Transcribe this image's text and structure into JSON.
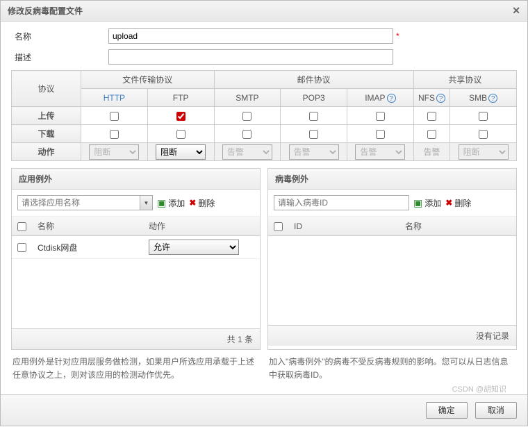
{
  "title": "修改反病毒配置文件",
  "form": {
    "name_label": "名称",
    "name_value": "upload",
    "desc_label": "描述",
    "desc_value": ""
  },
  "proto": {
    "col_protocol": "协议",
    "group_file": "文件传输协议",
    "group_mail": "邮件协议",
    "group_share": "共享协议",
    "http": "HTTP",
    "ftp": "FTP",
    "smtp": "SMTP",
    "pop3": "POP3",
    "imap": "IMAP",
    "nfs": "NFS",
    "smb": "SMB",
    "row_upload": "上传",
    "row_download": "下载",
    "row_action": "动作",
    "act_block": "阻断",
    "act_alert": "告警"
  },
  "app_ex": {
    "title": "应用例外",
    "placeholder": "请选择应用名称",
    "add": "添加",
    "del": "删除",
    "col_name": "名称",
    "col_action": "动作",
    "row1_name": "Ctdisk网盘",
    "row1_action": "允许",
    "pager": "共 1 条",
    "hint": "应用例外是针对应用层服务做检测，如果用户所选应用承载于上述任意协议之上，则对该应用的检测动作优先。"
  },
  "virus_ex": {
    "title": "病毒例外",
    "placeholder": "请输入病毒ID",
    "add": "添加",
    "del": "删除",
    "col_id": "ID",
    "col_name": "名称",
    "pager": "没有记录",
    "hint": "加入\"病毒例外\"的病毒不受反病毒规则的影响。您可以从日志信息中获取病毒ID。"
  },
  "buttons": {
    "ok": "确定",
    "cancel": "取消"
  },
  "watermark": "CSDN @胡知识"
}
